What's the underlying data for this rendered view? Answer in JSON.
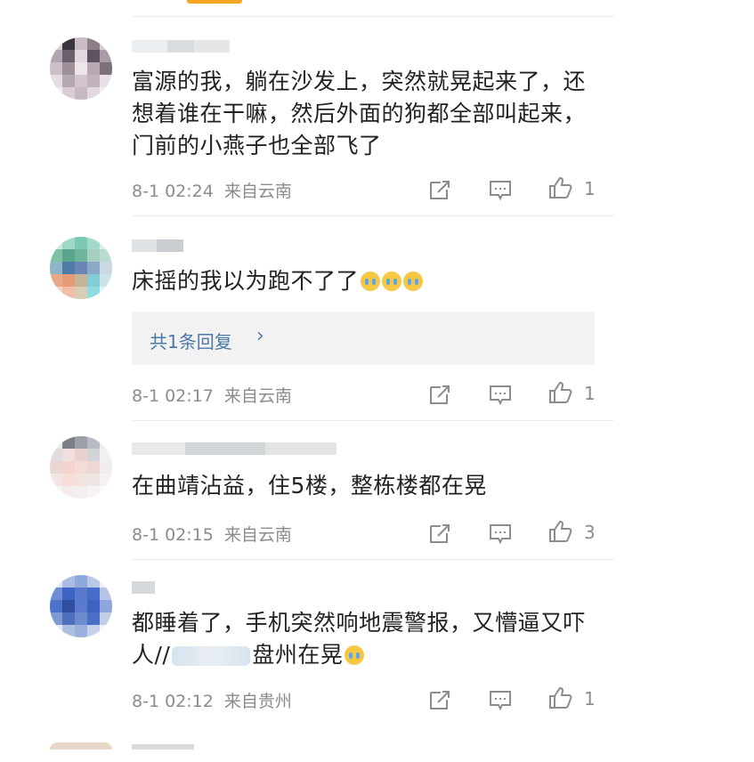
{
  "comments": [
    {
      "text": "富源的我，躺在沙发上，突然就晃起来了，还想着谁在干嘛，然后外面的狗都全部叫起来，门前的小燕子也全部飞了",
      "time": "8-1 02:24",
      "location": "来自云南",
      "likes": "1"
    },
    {
      "text": "床摇的我以为跑不了了",
      "reply_label": "共1条回复",
      "time": "8-1 02:17",
      "location": "来自云南",
      "likes": "1"
    },
    {
      "text": "在曲靖沾益，住5楼，整栋楼都在晃",
      "time": "8-1 02:15",
      "location": "来自云南",
      "likes": "3"
    },
    {
      "text_part1": "都睡着了，手机突然响地震警报，又懵逼又吓人//",
      "text_part2": "盘州在晃",
      "time": "8-1 02:12",
      "location": "来自贵州",
      "likes": "1"
    }
  ],
  "icons": {
    "share": "share-icon",
    "comment": "comment-icon",
    "like": "thumbs-up-icon"
  },
  "colors": {
    "link": "#4a78a8",
    "meta": "#8c8c8c",
    "accent": "#f5a623"
  }
}
